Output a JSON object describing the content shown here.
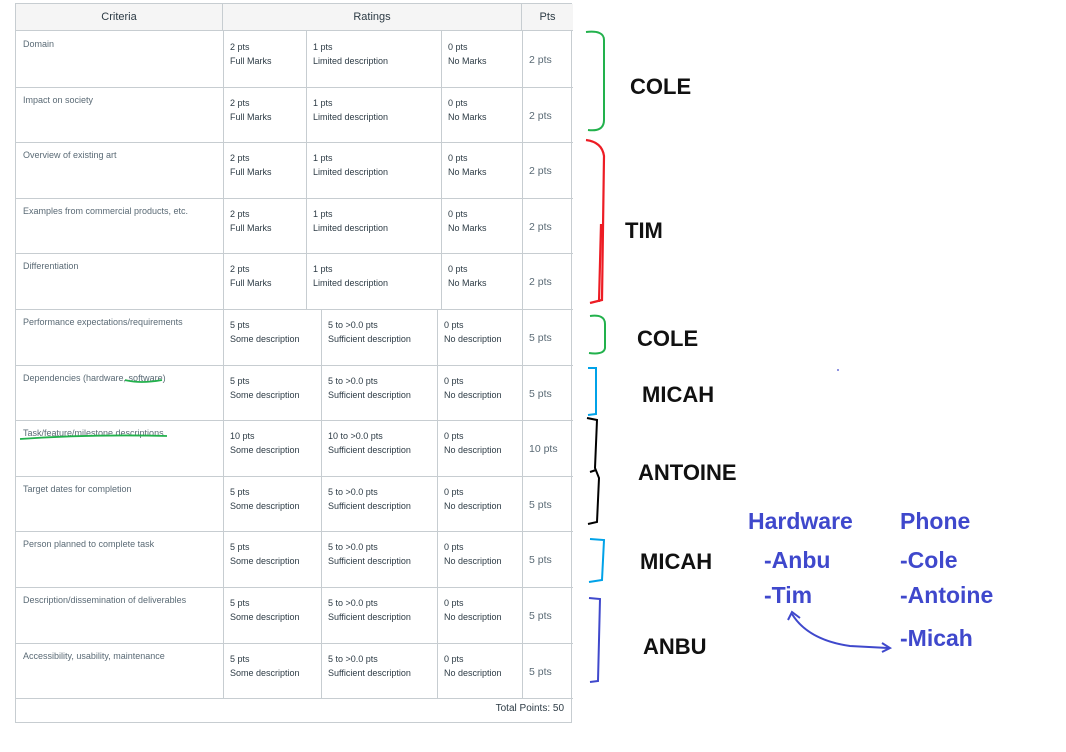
{
  "rubric": {
    "headers": {
      "criteria": "Criteria",
      "ratings": "Ratings",
      "pts": "Pts"
    },
    "rows": [
      {
        "criterion": "Domain",
        "r1_pts": "2 pts",
        "r1_desc": "Full Marks",
        "r2_pts": "1 pts",
        "r2_desc": "Limited description",
        "r3_pts": "0 pts",
        "r3_desc": "No Marks",
        "pts": "2 pts"
      },
      {
        "criterion": "Impact on society",
        "r1_pts": "2 pts",
        "r1_desc": "Full Marks",
        "r2_pts": "1 pts",
        "r2_desc": "Limited description",
        "r3_pts": "0 pts",
        "r3_desc": "No Marks",
        "pts": "2 pts"
      },
      {
        "criterion": "Overview of existing art",
        "r1_pts": "2 pts",
        "r1_desc": "Full Marks",
        "r2_pts": "1 pts",
        "r2_desc": "Limited description",
        "r3_pts": "0 pts",
        "r3_desc": "No Marks",
        "pts": "2 pts"
      },
      {
        "criterion": "Examples from commercial products, etc.",
        "r1_pts": "2 pts",
        "r1_desc": "Full Marks",
        "r2_pts": "1 pts",
        "r2_desc": "Limited description",
        "r3_pts": "0 pts",
        "r3_desc": "No Marks",
        "pts": "2 pts"
      },
      {
        "criterion": "Differentiation",
        "r1_pts": "2 pts",
        "r1_desc": "Full Marks",
        "r2_pts": "1 pts",
        "r2_desc": "Limited description",
        "r3_pts": "0 pts",
        "r3_desc": "No Marks",
        "pts": "2 pts"
      },
      {
        "criterion": "Performance expectations/requirements",
        "r1_pts": "5 pts",
        "r1_desc": "Some description",
        "r2_pts": "5 to >0.0 pts",
        "r2_desc": "Sufficient description",
        "r3_pts": "0 pts",
        "r3_desc": "No description",
        "pts": "5 pts"
      },
      {
        "criterion": "Dependencies (hardware, software)",
        "r1_pts": "5 pts",
        "r1_desc": "Some description",
        "r2_pts": "5 to >0.0 pts",
        "r2_desc": "Sufficient description",
        "r3_pts": "0 pts",
        "r3_desc": "No description",
        "pts": "5 pts"
      },
      {
        "criterion": "Task/feature/milestone descriptions",
        "r1_pts": "10 pts",
        "r1_desc": "Some description",
        "r2_pts": "10 to >0.0 pts",
        "r2_desc": "Sufficient description",
        "r3_pts": "0 pts",
        "r3_desc": "No description",
        "pts": "10 pts"
      },
      {
        "criterion": "Target dates for completion",
        "r1_pts": "5 pts",
        "r1_desc": "Some description",
        "r2_pts": "5 to >0.0 pts",
        "r2_desc": "Sufficient description",
        "r3_pts": "0 pts",
        "r3_desc": "No description",
        "pts": "5 pts"
      },
      {
        "criterion": "Person planned to complete task",
        "r1_pts": "5 pts",
        "r1_desc": "Some description",
        "r2_pts": "5 to >0.0 pts",
        "r2_desc": "Sufficient description",
        "r3_pts": "0 pts",
        "r3_desc": "No description",
        "pts": "5 pts"
      },
      {
        "criterion": "Description/dissemination of deliverables",
        "r1_pts": "5 pts",
        "r1_desc": "Some description",
        "r2_pts": "5 to >0.0 pts",
        "r2_desc": "Sufficient description",
        "r3_pts": "0 pts",
        "r3_desc": "No description",
        "pts": "5 pts"
      },
      {
        "criterion": "Accessibility, usability, maintenance",
        "r1_pts": "5 pts",
        "r1_desc": "Some description",
        "r2_pts": "5 to >0.0 pts",
        "r2_desc": "Sufficient description",
        "r3_pts": "0 pts",
        "r3_desc": "No description",
        "pts": "5 pts"
      }
    ],
    "total": "Total Points: 50"
  },
  "assignments": [
    "COLE",
    "TIM",
    "COLE",
    "MICAH",
    "ANTOINE",
    "MICAH",
    "ANBU"
  ],
  "annotation_colors": {
    "green": "#22b14c",
    "red": "#ed1c24",
    "cyan": "#00a2e8",
    "black": "#000000",
    "navy": "#3f48cc"
  },
  "teams": {
    "hardware": {
      "title": "Hardware",
      "members": [
        "-Anbu",
        "-Tim"
      ]
    },
    "phone": {
      "title": "Phone",
      "members": [
        "-Cole",
        "-Antoine",
        "-Micah"
      ]
    }
  }
}
